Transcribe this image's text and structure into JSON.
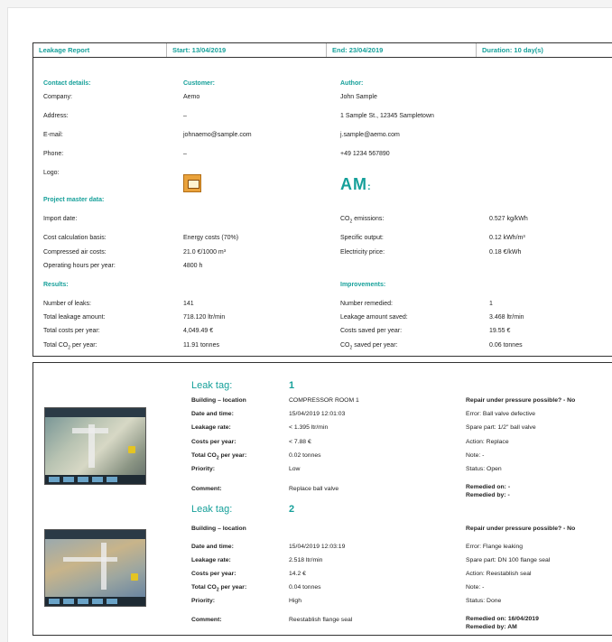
{
  "header": {
    "title": "Leakage Report",
    "start": "Start: 13/04/2019",
    "end": "End: 23/04/2019",
    "duration": "Duration: 10 day(s)"
  },
  "contact": {
    "section": "Contact details:",
    "customer_heading": "Customer:",
    "author_heading": "Author:",
    "rows": [
      {
        "label": "Company:",
        "customer": "Aemo",
        "author": "John Sample"
      },
      {
        "label": "Address:",
        "customer": "–",
        "author": "1 Sample St., 12345 Sampletown"
      },
      {
        "label": "E-mail:",
        "customer": "johnaemo@sample.com",
        "author": "j.sample@aemo.com"
      },
      {
        "label": "Phone:",
        "customer": "–",
        "author": "+49 1234 567890"
      },
      {
        "label": "Logo:",
        "customer": "",
        "author": ""
      }
    ],
    "author_logo": "AM"
  },
  "master": {
    "section": "Project master data:",
    "rows": [
      {
        "label": "Import date:",
        "value": "",
        "label2": "CO2 emissions:",
        "value2": "0.527 kg/kWh"
      },
      {
        "label": "Cost calculation basis:",
        "value": "Energy costs (70%)",
        "label2": "Specific output:",
        "value2": "0.12 kWh/m³"
      },
      {
        "label": "Compressed air costs:",
        "value": "21.0 €/1000 m³",
        "label2": "Electricity price:",
        "value2": "0.18 €/kWh"
      },
      {
        "label": "Operating hours per year:",
        "value": "4800 h",
        "label2": "",
        "value2": ""
      }
    ]
  },
  "results": {
    "section": "Results:",
    "improvements_heading": "Improvements:",
    "rows": [
      {
        "label": "Number of leaks:",
        "value": "141",
        "label2": "Number remedied:",
        "value2": "1"
      },
      {
        "label": "Total leakage amount:",
        "value": "718.120 ltr/min",
        "label2": "Leakage amount saved:",
        "value2": "3.468 ltr/min"
      },
      {
        "label": "Total costs per year:",
        "value": "4,049.49 €",
        "label2": "Costs saved per year:",
        "value2": "19.55 €"
      },
      {
        "label": "Total CO2 per year:",
        "value": "11.91 tonnes",
        "label2": "CO2 saved per year:",
        "value2": "0.06 tonnes"
      }
    ]
  },
  "tags": [
    {
      "title": "Leak tag:",
      "number": "1",
      "fields": [
        {
          "label": "Building – location",
          "value": "COMPRESSOR ROOM 1"
        },
        {
          "label": "Date and time:",
          "value": "15/04/2019 12:01:03"
        },
        {
          "label": "Leakage rate:",
          "value": "< 1.395 ltr/min"
        },
        {
          "label": "Costs per year:",
          "value": "< 7.88 €"
        },
        {
          "label": "Total CO2 per year:",
          "value": "0.02 tonnes"
        },
        {
          "label": "Priority:",
          "value": "Low"
        },
        {
          "label": "Comment:",
          "value": "Replace ball valve"
        }
      ],
      "right": [
        "Repair under pressure possible? - No",
        "Error: Ball valve defective",
        "Spare part: 1/2\" ball valve",
        "Action: Replace",
        "Note: -",
        "Status: Open",
        "Remedied on: -",
        "Remedied by: -"
      ]
    },
    {
      "title": "Leak tag:",
      "number": "2",
      "fields": [
        {
          "label": "Building – location",
          "value": ""
        },
        {
          "label": "Date and time:",
          "value": "15/04/2019 12:03:19"
        },
        {
          "label": "Leakage rate:",
          "value": "2.518 ltr/min"
        },
        {
          "label": "Costs per year:",
          "value": "14.2 €"
        },
        {
          "label": "Total CO2 per year:",
          "value": "0.04 tonnes"
        },
        {
          "label": "Priority:",
          "value": "High"
        },
        {
          "label": "Comment:",
          "value": "Reestablish flange seal"
        }
      ],
      "right": [
        "Repair under pressure possible? - No",
        "Error: Flange leaking",
        "Spare part: DN 100 flange seal",
        "Action: Reestablish seal",
        "Note: -",
        "Status: Done",
        "Remedied on: 16/04/2019",
        "Remedied by: AM"
      ]
    }
  ]
}
